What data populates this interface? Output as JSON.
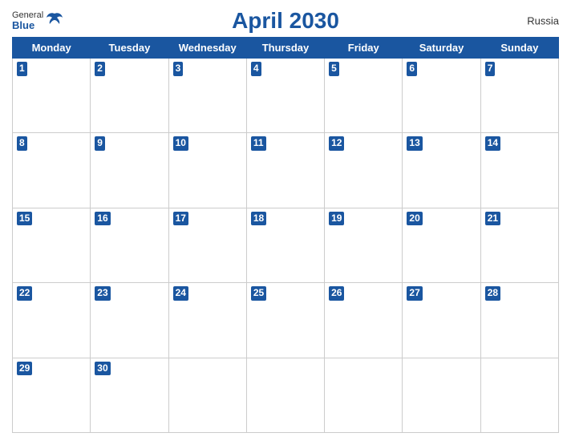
{
  "header": {
    "logo_general": "General",
    "logo_blue": "Blue",
    "title": "April 2030",
    "country": "Russia"
  },
  "days_of_week": [
    "Monday",
    "Tuesday",
    "Wednesday",
    "Thursday",
    "Friday",
    "Saturday",
    "Sunday"
  ],
  "weeks": [
    [
      1,
      2,
      3,
      4,
      5,
      6,
      7
    ],
    [
      8,
      9,
      10,
      11,
      12,
      13,
      14
    ],
    [
      15,
      16,
      17,
      18,
      19,
      20,
      21
    ],
    [
      22,
      23,
      24,
      25,
      26,
      27,
      28
    ],
    [
      29,
      30,
      null,
      null,
      null,
      null,
      null
    ]
  ],
  "colors": {
    "header_bg": "#1a56a0",
    "header_text": "#ffffff",
    "date_bg": "#1a56a0",
    "border": "#cccccc"
  }
}
